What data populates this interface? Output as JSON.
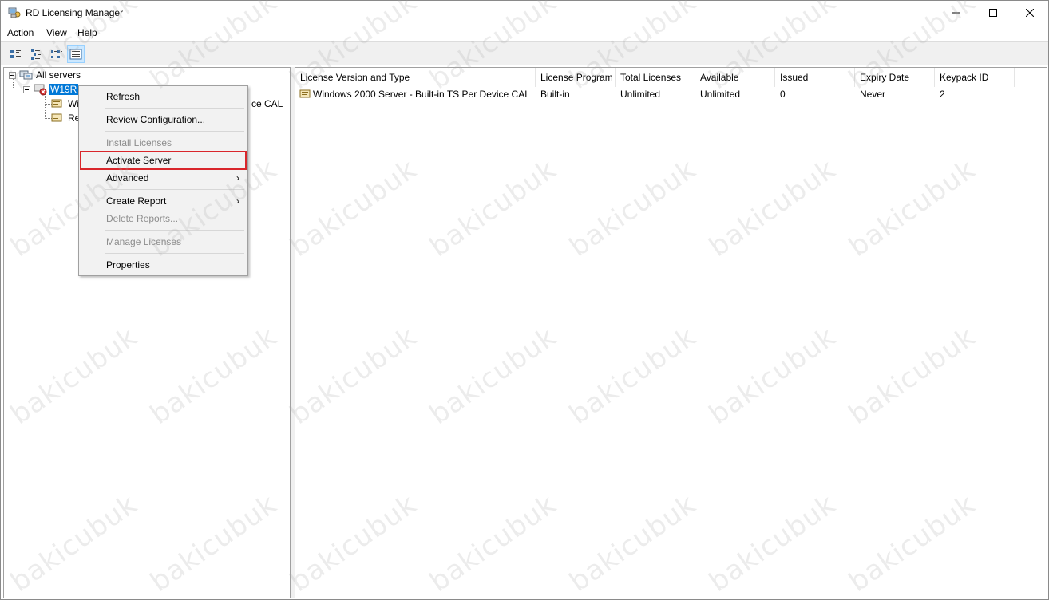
{
  "window": {
    "title": "RD Licensing Manager",
    "icons": {
      "app": "rd-licensing-app-icon"
    }
  },
  "menubar": {
    "items": [
      "Action",
      "View",
      "Help"
    ]
  },
  "toolbar": {
    "buttons": [
      "large-icons-view-icon",
      "small-icons-view-icon",
      "list-view-icon",
      "details-view-icon"
    ],
    "active": "details-view-icon"
  },
  "tree": {
    "root": "All servers",
    "server": "W19R",
    "child1": "Wi",
    "child1_tail": "ce CAL",
    "child2": "Re"
  },
  "list": {
    "columns": [
      "License Version and Type",
      "License Program",
      "Total Licenses",
      "Available",
      "Issued",
      "Expiry Date",
      "Keypack ID"
    ],
    "rows": [
      [
        "Windows 2000 Server - Built-in TS Per Device CAL",
        "Built-in",
        "Unlimited",
        "Unlimited",
        "0",
        "Never",
        "2"
      ]
    ]
  },
  "context_menu": {
    "items": [
      {
        "label": "Refresh",
        "enabled": true
      },
      {
        "label": "Review Configuration...",
        "enabled": true
      },
      {
        "label": "Install Licenses",
        "enabled": false
      },
      {
        "label": "Activate Server",
        "enabled": true,
        "highlighted": true
      },
      {
        "label": "Advanced",
        "enabled": true,
        "submenu": true
      },
      {
        "label": "Create Report",
        "enabled": true,
        "submenu": true
      },
      {
        "label": "Delete Reports...",
        "enabled": false
      },
      {
        "label": "Manage Licenses",
        "enabled": false
      },
      {
        "label": "Properties",
        "enabled": true
      }
    ],
    "submenu_arrow": "›"
  },
  "watermark": "bakicubuk",
  "colors": {
    "selection": "#0078d7",
    "highlight_border": "#d9262b",
    "toolbar_active": "#cce8ff"
  }
}
